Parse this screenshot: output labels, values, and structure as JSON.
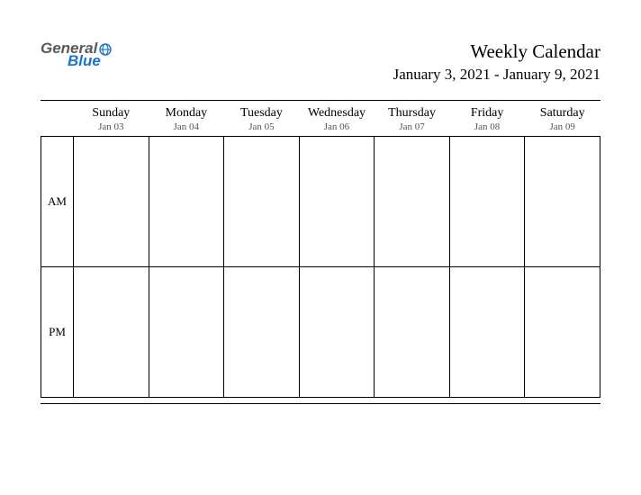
{
  "logo": {
    "part1": "General",
    "part2": "Blue"
  },
  "header": {
    "title": "Weekly Calendar",
    "date_range": "January 3, 2021 - January 9, 2021"
  },
  "days": [
    {
      "name": "Sunday",
      "date": "Jan 03"
    },
    {
      "name": "Monday",
      "date": "Jan 04"
    },
    {
      "name": "Tuesday",
      "date": "Jan 05"
    },
    {
      "name": "Wednesday",
      "date": "Jan 06"
    },
    {
      "name": "Thursday",
      "date": "Jan 07"
    },
    {
      "name": "Friday",
      "date": "Jan 08"
    },
    {
      "name": "Saturday",
      "date": "Jan 09"
    }
  ],
  "time_rows": [
    "AM",
    "PM"
  ]
}
